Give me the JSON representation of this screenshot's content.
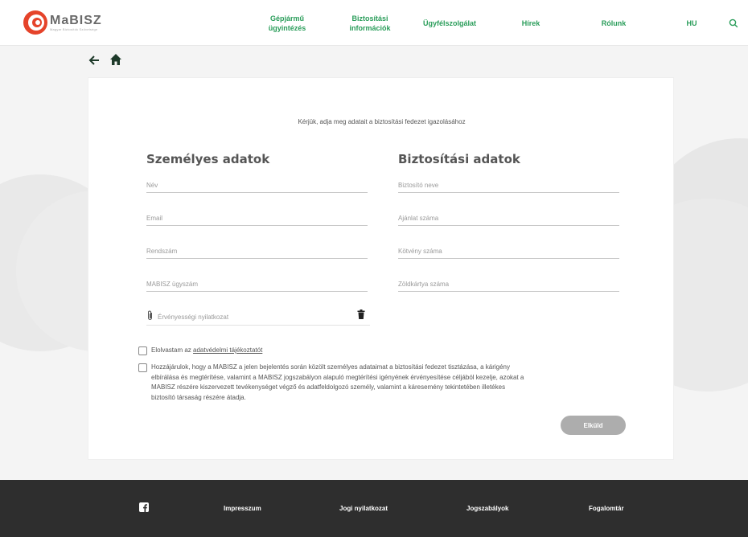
{
  "header": {
    "logo_text": "MaBISZ",
    "logo_tagline": "Magyar Biztosítók Szövetsége",
    "nav": [
      {
        "line1": "Gépjármű",
        "line2": "ügyintézés"
      },
      {
        "line1": "Biztosítási",
        "line2": "információk"
      },
      {
        "line1": "Ügyfélszolgálat",
        "line2": ""
      },
      {
        "line1": "Hírek",
        "line2": ""
      },
      {
        "line1": "Rólunk",
        "line2": ""
      },
      {
        "line1": "HU",
        "line2": ""
      }
    ]
  },
  "form": {
    "intro": "Kérjük, adja meg adatait a biztosítási fedezet igazolásához",
    "personal_title": "Személyes adatok",
    "insurance_title": "Biztosítási adatok",
    "personal_fields": {
      "name": "Név",
      "email": "Email",
      "plate": "Rendszám",
      "case_no": "MABISZ ügyszám"
    },
    "insurance_fields": {
      "insurer": "Biztosító neve",
      "offer_no": "Ajánlat száma",
      "policy_no": "Kötvény száma",
      "greencard_no": "Zöldkártya száma"
    },
    "attachment_label": "Érvényességi nyilatkozat",
    "privacy_prefix": "Elolvastam az ",
    "privacy_link": "adatvédelmi tájékoztatót",
    "consent_lines": [
      "Hozzájárulok, hogy a MABISZ a jelen bejelentés során közölt személyes adataimat a biztosítási fedezet tisztázása, a kárigény",
      "elbírálása és megtérítése, valamint a MABISZ jogszabályon alapuló megtérítési igényének érvényesítése céljából kezelje, azokat a",
      "MABISZ részére kiszervezett tevékenységet végző és adatfeldolgozó személy, valamint a káresemény tekintetében illetékes",
      "biztosító társaság részére átadja."
    ],
    "submit_label": "Elküld"
  },
  "footer": {
    "links": [
      "Impresszum",
      "Jogi nyilatkozat",
      "Jogszabályok",
      "Fogalomtár"
    ]
  },
  "colors": {
    "accent_green": "#2a9d5a",
    "logo_red": "#e5432a",
    "footer_bg": "#2e2e2e",
    "button_disabled": "#adadad"
  },
  "icons": [
    "logo-mark",
    "search-icon",
    "back-arrow-icon",
    "home-icon",
    "paperclip-icon",
    "trash-icon",
    "facebook-icon"
  ]
}
